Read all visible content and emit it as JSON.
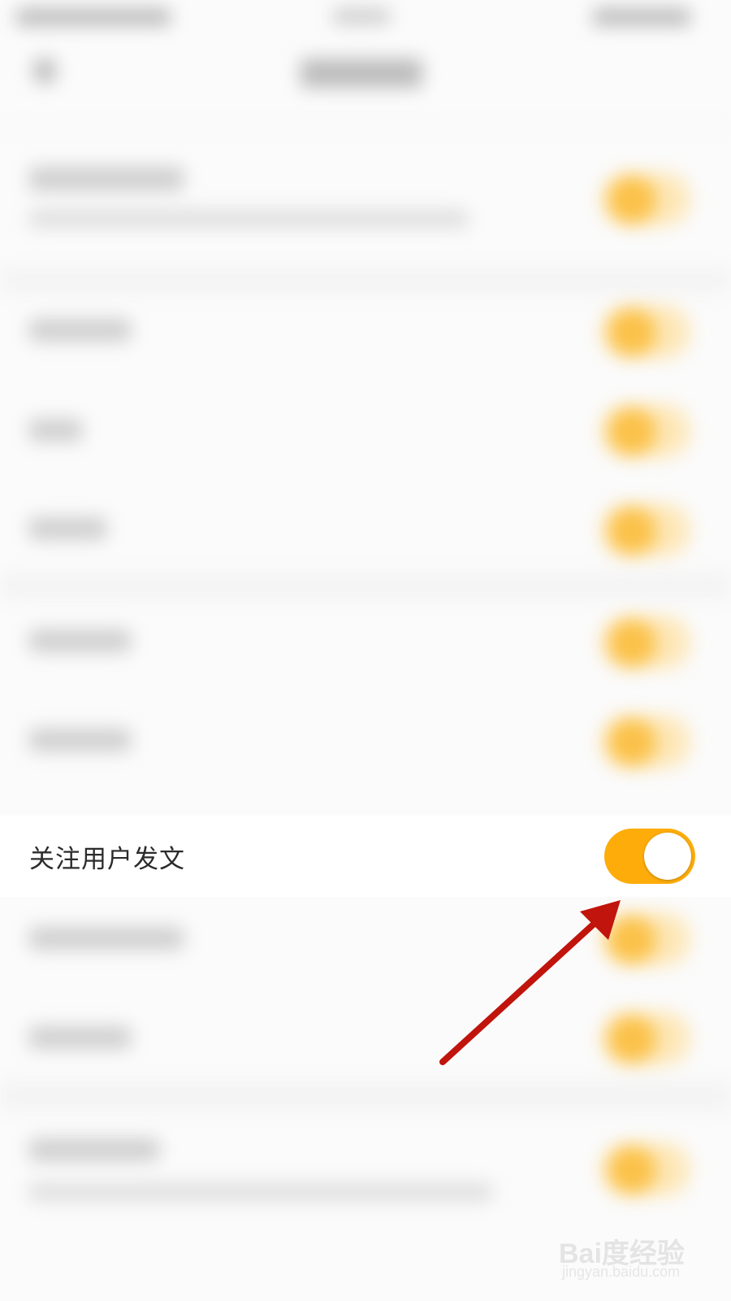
{
  "settings_row": {
    "label": "关注用户发文",
    "toggle_on": true,
    "toggle_color": "#fdac0a"
  },
  "watermark": {
    "brand": "Bai度经验",
    "site": "jingyan.baidu.com"
  },
  "annotation": {
    "arrow_color": "#c0140c"
  },
  "blurred_rows_toggle_color": "#fbc24a"
}
